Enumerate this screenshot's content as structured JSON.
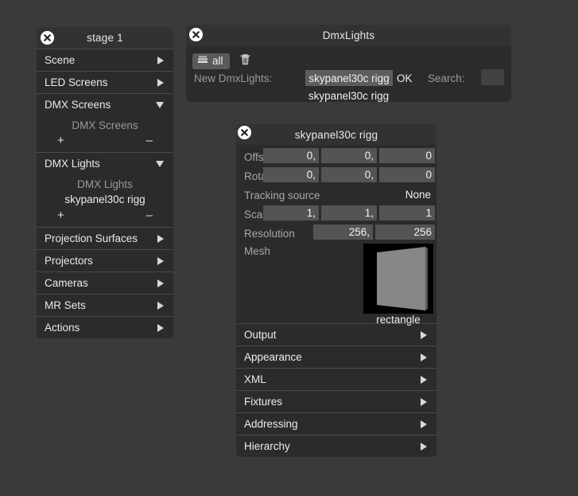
{
  "colors": {
    "app_background": "#3a3a3a",
    "panel_background": "#2b2b2b",
    "titlebar": "#323232",
    "field": "#545454",
    "label_text": "#a8a8a8",
    "value_text": "#f2f2f2"
  },
  "outline_panel": {
    "title": "stage 1",
    "close_icon": "close-circle-icon",
    "rows": [
      {
        "label": "Scene",
        "state": "collapsed",
        "icon": "chevron-right-icon"
      },
      {
        "label": "LED Screens",
        "state": "collapsed",
        "icon": "chevron-right-icon"
      },
      {
        "label": "DMX Screens",
        "state": "expanded",
        "icon": "chevron-down-icon"
      },
      {
        "label": "DMX Lights",
        "state": "expanded",
        "icon": "chevron-down-icon"
      },
      {
        "label": "Projection Surfaces",
        "state": "collapsed",
        "icon": "chevron-right-icon"
      },
      {
        "label": "Projectors",
        "state": "collapsed",
        "icon": "chevron-right-icon"
      },
      {
        "label": "Cameras",
        "state": "collapsed",
        "icon": "chevron-right-icon"
      },
      {
        "label": "MR Sets",
        "state": "collapsed",
        "icon": "chevron-right-icon"
      },
      {
        "label": "Actions",
        "state": "collapsed",
        "icon": "chevron-right-icon"
      }
    ],
    "dmx_screens_group": {
      "heading": "DMX Screens",
      "items": [],
      "add_label": "+",
      "remove_label": "–"
    },
    "dmx_lights_group": {
      "heading": "DMX Lights",
      "items": [
        "skypanel30c rigg"
      ],
      "add_label": "+",
      "remove_label": "–"
    }
  },
  "dmxlights_dialog": {
    "title": "DmxLights",
    "close_icon": "close-circle-icon",
    "toolbar": {
      "all_button_label": "all",
      "all_button_icon": "layers-icon",
      "delete_icon": "trash-icon"
    },
    "new_label": "New DmxLights:",
    "new_value": "skypanel30c rigg",
    "ok_label": "OK",
    "search_label": "Search:",
    "search_value": "",
    "search_placeholder": "",
    "result_item": "skypanel30c rigg"
  },
  "properties_panel": {
    "title": "skypanel30c rigg",
    "close_icon": "close-circle-icon",
    "rows": [
      {
        "label": "Offset",
        "type": "vec3",
        "values": [
          "0,",
          "0,",
          "0"
        ]
      },
      {
        "label": "Rotation",
        "type": "vec3",
        "values": [
          "0,",
          "0,",
          "0"
        ]
      },
      {
        "label": "Tracking source",
        "type": "plain",
        "value": "None"
      },
      {
        "label": "Scale",
        "type": "vec3",
        "values": [
          "1,",
          "1,",
          "1"
        ]
      },
      {
        "label": "Resolution",
        "type": "vec2",
        "values": [
          "256,",
          "256"
        ]
      }
    ],
    "mesh": {
      "label": "Mesh",
      "thumbnail_icon": "rectangle-mesh-preview",
      "caption": "rectangle"
    },
    "sections": [
      {
        "label": "Output",
        "icon": "chevron-right-icon"
      },
      {
        "label": "Appearance",
        "icon": "chevron-right-icon"
      },
      {
        "label": "XML",
        "icon": "chevron-right-icon"
      },
      {
        "label": "Fixtures",
        "icon": "chevron-right-icon"
      },
      {
        "label": "Addressing",
        "icon": "chevron-right-icon"
      },
      {
        "label": "Hierarchy",
        "icon": "chevron-right-icon"
      }
    ]
  }
}
